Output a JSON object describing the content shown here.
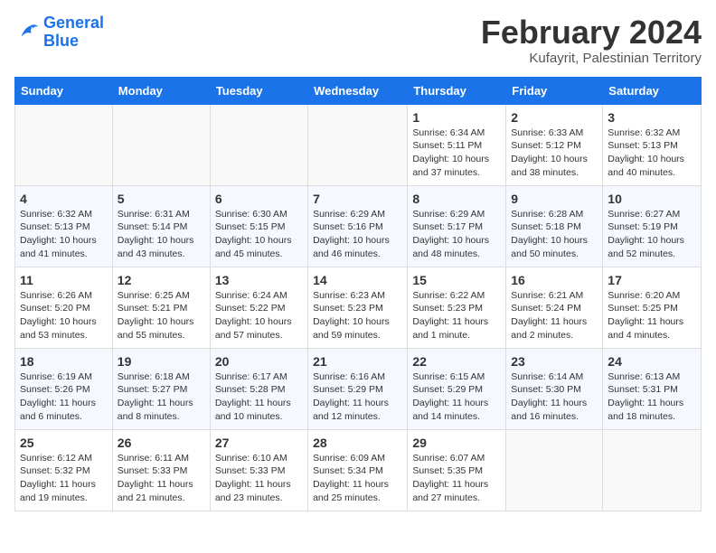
{
  "logo": {
    "line1": "General",
    "line2": "Blue"
  },
  "title": "February 2024",
  "location": "Kufayrit, Palestinian Territory",
  "days_of_week": [
    "Sunday",
    "Monday",
    "Tuesday",
    "Wednesday",
    "Thursday",
    "Friday",
    "Saturday"
  ],
  "weeks": [
    [
      {
        "day": "",
        "info": ""
      },
      {
        "day": "",
        "info": ""
      },
      {
        "day": "",
        "info": ""
      },
      {
        "day": "",
        "info": ""
      },
      {
        "day": "1",
        "info": "Sunrise: 6:34 AM\nSunset: 5:11 PM\nDaylight: 10 hours\nand 37 minutes."
      },
      {
        "day": "2",
        "info": "Sunrise: 6:33 AM\nSunset: 5:12 PM\nDaylight: 10 hours\nand 38 minutes."
      },
      {
        "day": "3",
        "info": "Sunrise: 6:32 AM\nSunset: 5:13 PM\nDaylight: 10 hours\nand 40 minutes."
      }
    ],
    [
      {
        "day": "4",
        "info": "Sunrise: 6:32 AM\nSunset: 5:13 PM\nDaylight: 10 hours\nand 41 minutes."
      },
      {
        "day": "5",
        "info": "Sunrise: 6:31 AM\nSunset: 5:14 PM\nDaylight: 10 hours\nand 43 minutes."
      },
      {
        "day": "6",
        "info": "Sunrise: 6:30 AM\nSunset: 5:15 PM\nDaylight: 10 hours\nand 45 minutes."
      },
      {
        "day": "7",
        "info": "Sunrise: 6:29 AM\nSunset: 5:16 PM\nDaylight: 10 hours\nand 46 minutes."
      },
      {
        "day": "8",
        "info": "Sunrise: 6:29 AM\nSunset: 5:17 PM\nDaylight: 10 hours\nand 48 minutes."
      },
      {
        "day": "9",
        "info": "Sunrise: 6:28 AM\nSunset: 5:18 PM\nDaylight: 10 hours\nand 50 minutes."
      },
      {
        "day": "10",
        "info": "Sunrise: 6:27 AM\nSunset: 5:19 PM\nDaylight: 10 hours\nand 52 minutes."
      }
    ],
    [
      {
        "day": "11",
        "info": "Sunrise: 6:26 AM\nSunset: 5:20 PM\nDaylight: 10 hours\nand 53 minutes."
      },
      {
        "day": "12",
        "info": "Sunrise: 6:25 AM\nSunset: 5:21 PM\nDaylight: 10 hours\nand 55 minutes."
      },
      {
        "day": "13",
        "info": "Sunrise: 6:24 AM\nSunset: 5:22 PM\nDaylight: 10 hours\nand 57 minutes."
      },
      {
        "day": "14",
        "info": "Sunrise: 6:23 AM\nSunset: 5:23 PM\nDaylight: 10 hours\nand 59 minutes."
      },
      {
        "day": "15",
        "info": "Sunrise: 6:22 AM\nSunset: 5:23 PM\nDaylight: 11 hours\nand 1 minute."
      },
      {
        "day": "16",
        "info": "Sunrise: 6:21 AM\nSunset: 5:24 PM\nDaylight: 11 hours\nand 2 minutes."
      },
      {
        "day": "17",
        "info": "Sunrise: 6:20 AM\nSunset: 5:25 PM\nDaylight: 11 hours\nand 4 minutes."
      }
    ],
    [
      {
        "day": "18",
        "info": "Sunrise: 6:19 AM\nSunset: 5:26 PM\nDaylight: 11 hours\nand 6 minutes."
      },
      {
        "day": "19",
        "info": "Sunrise: 6:18 AM\nSunset: 5:27 PM\nDaylight: 11 hours\nand 8 minutes."
      },
      {
        "day": "20",
        "info": "Sunrise: 6:17 AM\nSunset: 5:28 PM\nDaylight: 11 hours\nand 10 minutes."
      },
      {
        "day": "21",
        "info": "Sunrise: 6:16 AM\nSunset: 5:29 PM\nDaylight: 11 hours\nand 12 minutes."
      },
      {
        "day": "22",
        "info": "Sunrise: 6:15 AM\nSunset: 5:29 PM\nDaylight: 11 hours\nand 14 minutes."
      },
      {
        "day": "23",
        "info": "Sunrise: 6:14 AM\nSunset: 5:30 PM\nDaylight: 11 hours\nand 16 minutes."
      },
      {
        "day": "24",
        "info": "Sunrise: 6:13 AM\nSunset: 5:31 PM\nDaylight: 11 hours\nand 18 minutes."
      }
    ],
    [
      {
        "day": "25",
        "info": "Sunrise: 6:12 AM\nSunset: 5:32 PM\nDaylight: 11 hours\nand 19 minutes."
      },
      {
        "day": "26",
        "info": "Sunrise: 6:11 AM\nSunset: 5:33 PM\nDaylight: 11 hours\nand 21 minutes."
      },
      {
        "day": "27",
        "info": "Sunrise: 6:10 AM\nSunset: 5:33 PM\nDaylight: 11 hours\nand 23 minutes."
      },
      {
        "day": "28",
        "info": "Sunrise: 6:09 AM\nSunset: 5:34 PM\nDaylight: 11 hours\nand 25 minutes."
      },
      {
        "day": "29",
        "info": "Sunrise: 6:07 AM\nSunset: 5:35 PM\nDaylight: 11 hours\nand 27 minutes."
      },
      {
        "day": "",
        "info": ""
      },
      {
        "day": "",
        "info": ""
      }
    ]
  ]
}
